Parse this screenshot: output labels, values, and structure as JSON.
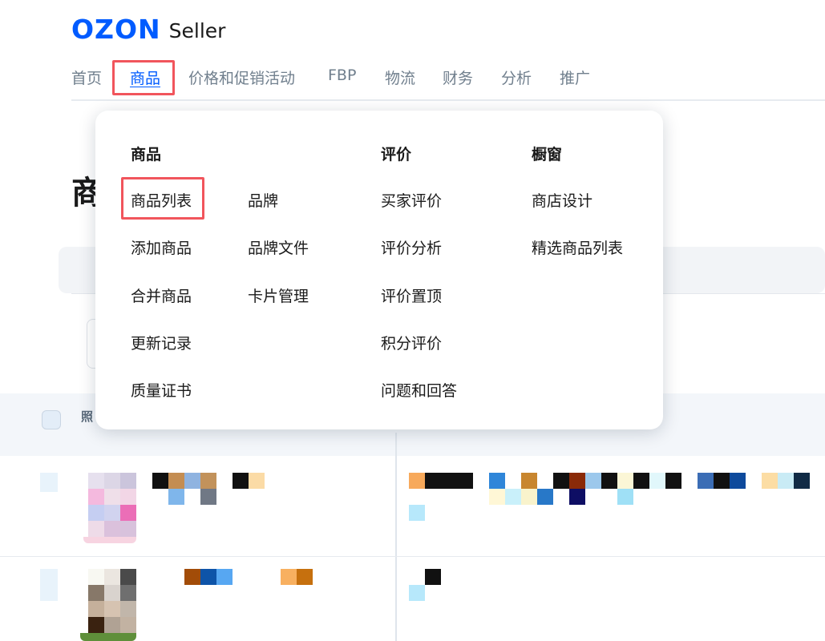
{
  "logo": {
    "brand": "OZON",
    "suffix": "Seller"
  },
  "nav": {
    "home": "首页",
    "products": "商品",
    "pricing": "价格和促销活动",
    "fbp": "FBP",
    "logistics": "物流",
    "finance": "财务",
    "analytics": "分析",
    "promotion": "推广"
  },
  "page": {
    "title": "商",
    "table_header": "照"
  },
  "menu": {
    "col1": {
      "heading": "商品",
      "items": [
        "商品列表",
        "添加商品",
        "合并商品",
        "更新记录",
        "质量证书"
      ]
    },
    "col2": {
      "items": [
        "品牌",
        "品牌文件",
        "卡片管理"
      ]
    },
    "col3": {
      "heading": "评价",
      "items": [
        "买家评价",
        "评价分析",
        "评价置顶",
        "积分评价",
        "问题和回答"
      ]
    },
    "col4": {
      "heading": "橱窗",
      "items": [
        "商店设计",
        "精选商品列表"
      ]
    }
  },
  "colors": {
    "brand": "#005bff",
    "highlight": "#f1555c",
    "nav_text": "#707f8d"
  }
}
